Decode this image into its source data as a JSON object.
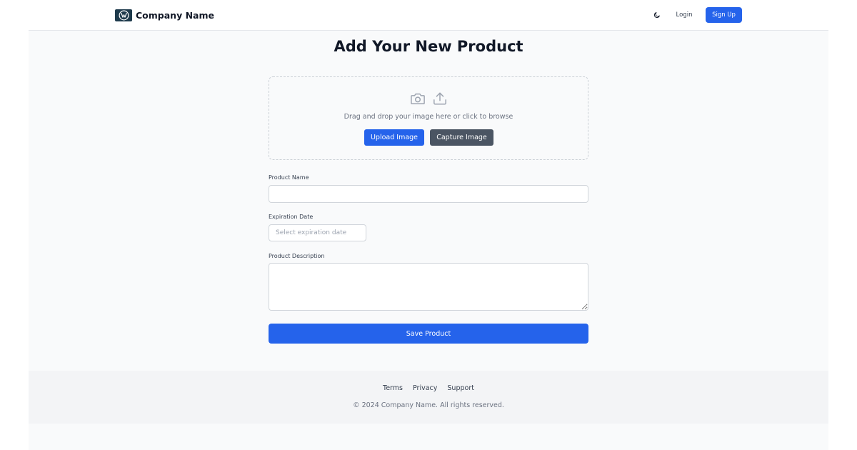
{
  "header": {
    "brand_name": "Company Name",
    "login_label": "Login",
    "signup_label": "Sign Up",
    "theme_icon": "moon-icon"
  },
  "main": {
    "title": "Add Your New Product",
    "dropzone": {
      "icons": [
        "camera-icon",
        "upload-icon"
      ],
      "instruction": "Drag and drop your image here or click to browse",
      "upload_label": "Upload Image",
      "capture_label": "Capture Image"
    },
    "fields": {
      "product_name": {
        "label": "Product Name",
        "value": ""
      },
      "expiration_date": {
        "label": "Expiration Date",
        "placeholder": "Select expiration date",
        "value": ""
      },
      "product_description": {
        "label": "Product Description",
        "value": ""
      }
    },
    "save_label": "Save Product"
  },
  "footer": {
    "links": [
      "Terms",
      "Privacy",
      "Support"
    ],
    "copyright": "© 2024 Company Name. All rights reserved."
  },
  "colors": {
    "primary": "#2563eb",
    "secondary_button": "#4b5563",
    "page_background": "#f9fafb",
    "footer_background": "#f3f4f6"
  }
}
